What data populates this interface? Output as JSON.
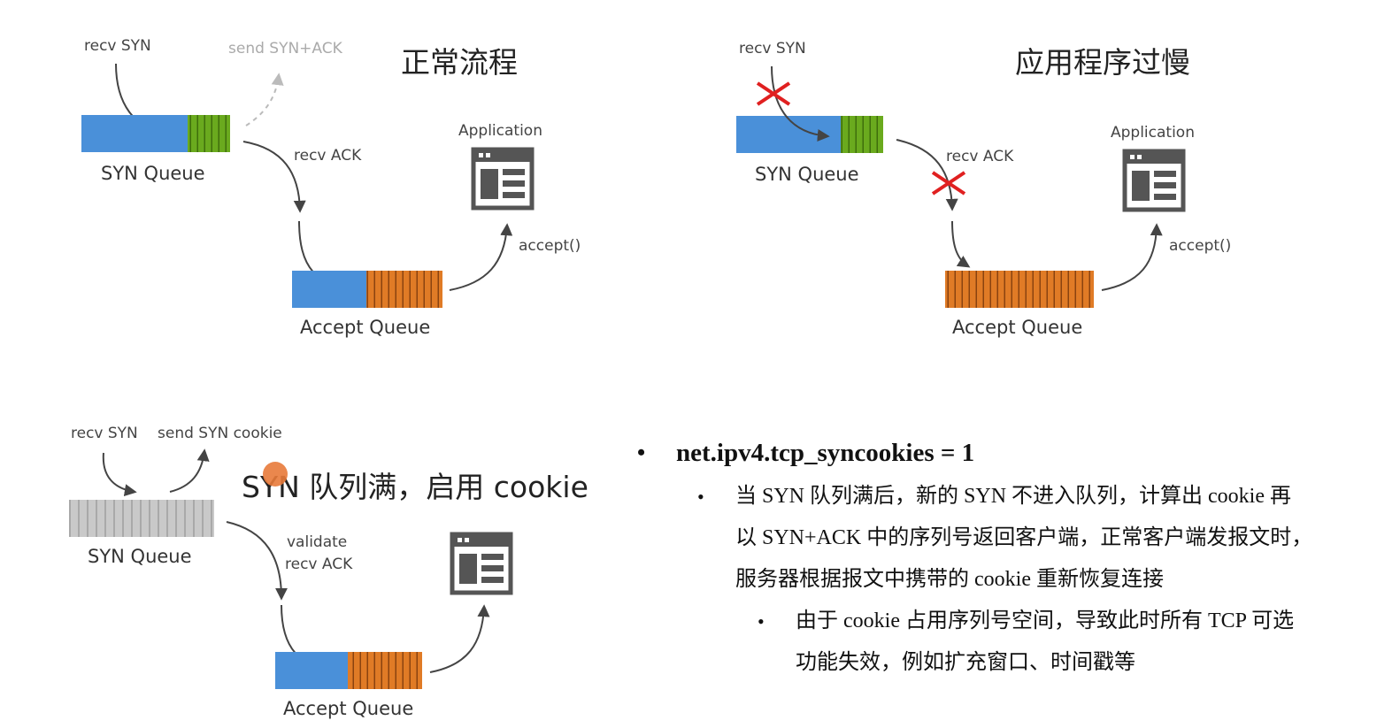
{
  "colors": {
    "syn_blue": "#4a90d9",
    "syn_green": "#6aaa1e",
    "accept_orange": "#e07b26",
    "syn_gray": "#c4c4c4",
    "arrow": "#444444",
    "cross": "#e02020",
    "cursor": "#e87a3a"
  },
  "icons": [
    "application-window-icon",
    "cross-icon"
  ],
  "panels": {
    "normal": {
      "title": "正常流程",
      "recv_syn": "recv SYN",
      "send_syn_ack": "send SYN+ACK",
      "recv_ack": "recv ACK",
      "application": "Application",
      "accept_call": "accept()",
      "syn_queue": "SYN Queue",
      "accept_queue": "Accept Queue"
    },
    "slow_app": {
      "title": "应用程序过慢",
      "recv_syn": "recv SYN",
      "recv_ack": "recv ACK",
      "application": "Application",
      "accept_call": "accept()",
      "syn_queue": "SYN Queue",
      "accept_queue": "Accept Queue"
    },
    "cookie": {
      "title": "SYN 队列满，启用 cookie",
      "recv_syn": "recv SYN",
      "send_syn_cookie": "send SYN cookie",
      "validate": "validate",
      "recv_ack": "recv ACK",
      "syn_queue": "SYN Queue",
      "accept_queue": "Accept Queue"
    }
  },
  "notes": {
    "setting": "net.ipv4.tcp_syncookies = 1",
    "line1": "当 SYN 队列满后，新的 SYN 不进入队列，计算出 cookie 再",
    "line2": "以 SYN+ACK 中的序列号返回客户端，正常客户端发报文时，",
    "line3": "服务器根据报文中携带的 cookie 重新恢复连接",
    "sub_line1": "由于 cookie 占用序列号空间，导致此时所有 TCP 可选",
    "sub_line2": "功能失效，例如扩充窗口、时间戳等"
  }
}
